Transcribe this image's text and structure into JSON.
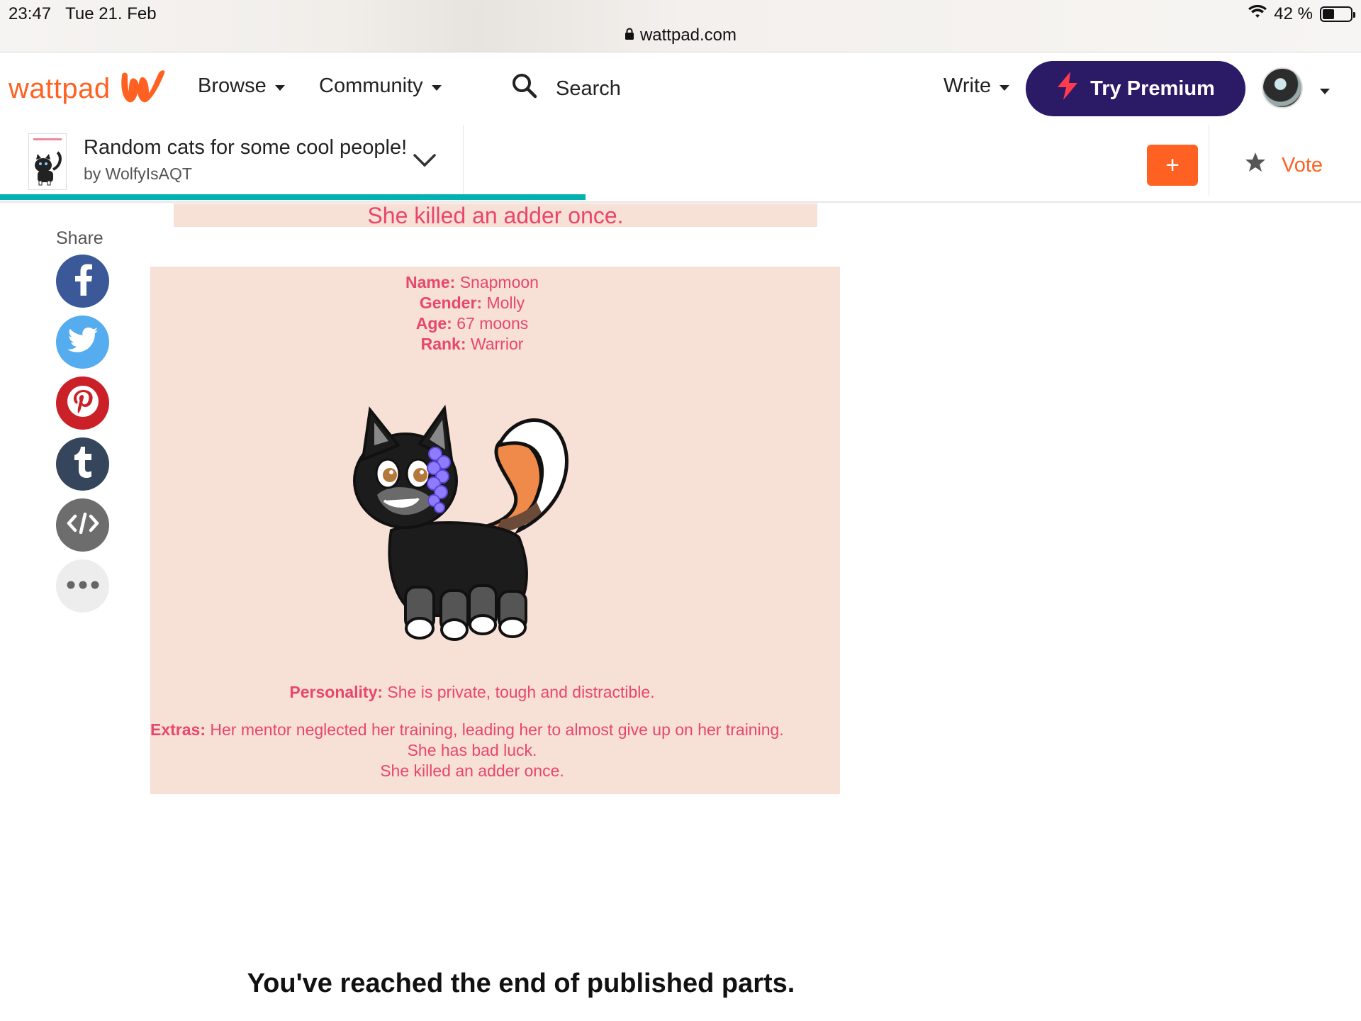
{
  "status_bar": {
    "time": "23:47",
    "date": "Tue 21. Feb",
    "battery": "42 %",
    "battery_level": 0.42,
    "url": "wattpad.com"
  },
  "nav": {
    "logo": "wattpad",
    "browse": "Browse",
    "community": "Community",
    "search": "Search",
    "write": "Write",
    "premium": "Try Premium"
  },
  "story": {
    "title": "Random cats for some cool people!",
    "author": "by WolfyIsAQT",
    "add": "+",
    "vote": "Vote",
    "reading_progress": 0.43
  },
  "share": {
    "label": "Share",
    "icons": [
      "facebook-icon",
      "twitter-icon",
      "pinterest-icon",
      "tumblr-icon",
      "embed-icon",
      "more-icon"
    ]
  },
  "content": {
    "top_strip": "She killed an adder once.",
    "name_label": "Name:",
    "name_value": " Snapmoon",
    "gender_label": "Gender:",
    "gender_value": " Molly",
    "age_label": "Age:",
    "age_value": " 67 moons",
    "rank_label": "Rank:",
    "rank_value": " Warrior",
    "personality_label": "Personality:",
    "personality_value": " She is private, tough and distractible.",
    "extras_label": "Extras:",
    "extras_line1": " Her mentor neglected her training, leading her to almost give up on her training.",
    "extras_line2": "She has bad luck.",
    "extras_line3": "She killed an adder once.",
    "end_message": "You've reached the end of published parts."
  },
  "colors": {
    "brand": "#ff6122",
    "premium_bg": "#2b1a66",
    "progress": "#00b2b2",
    "card_bg": "#f7e0d6",
    "card_text": "#e8466b"
  }
}
